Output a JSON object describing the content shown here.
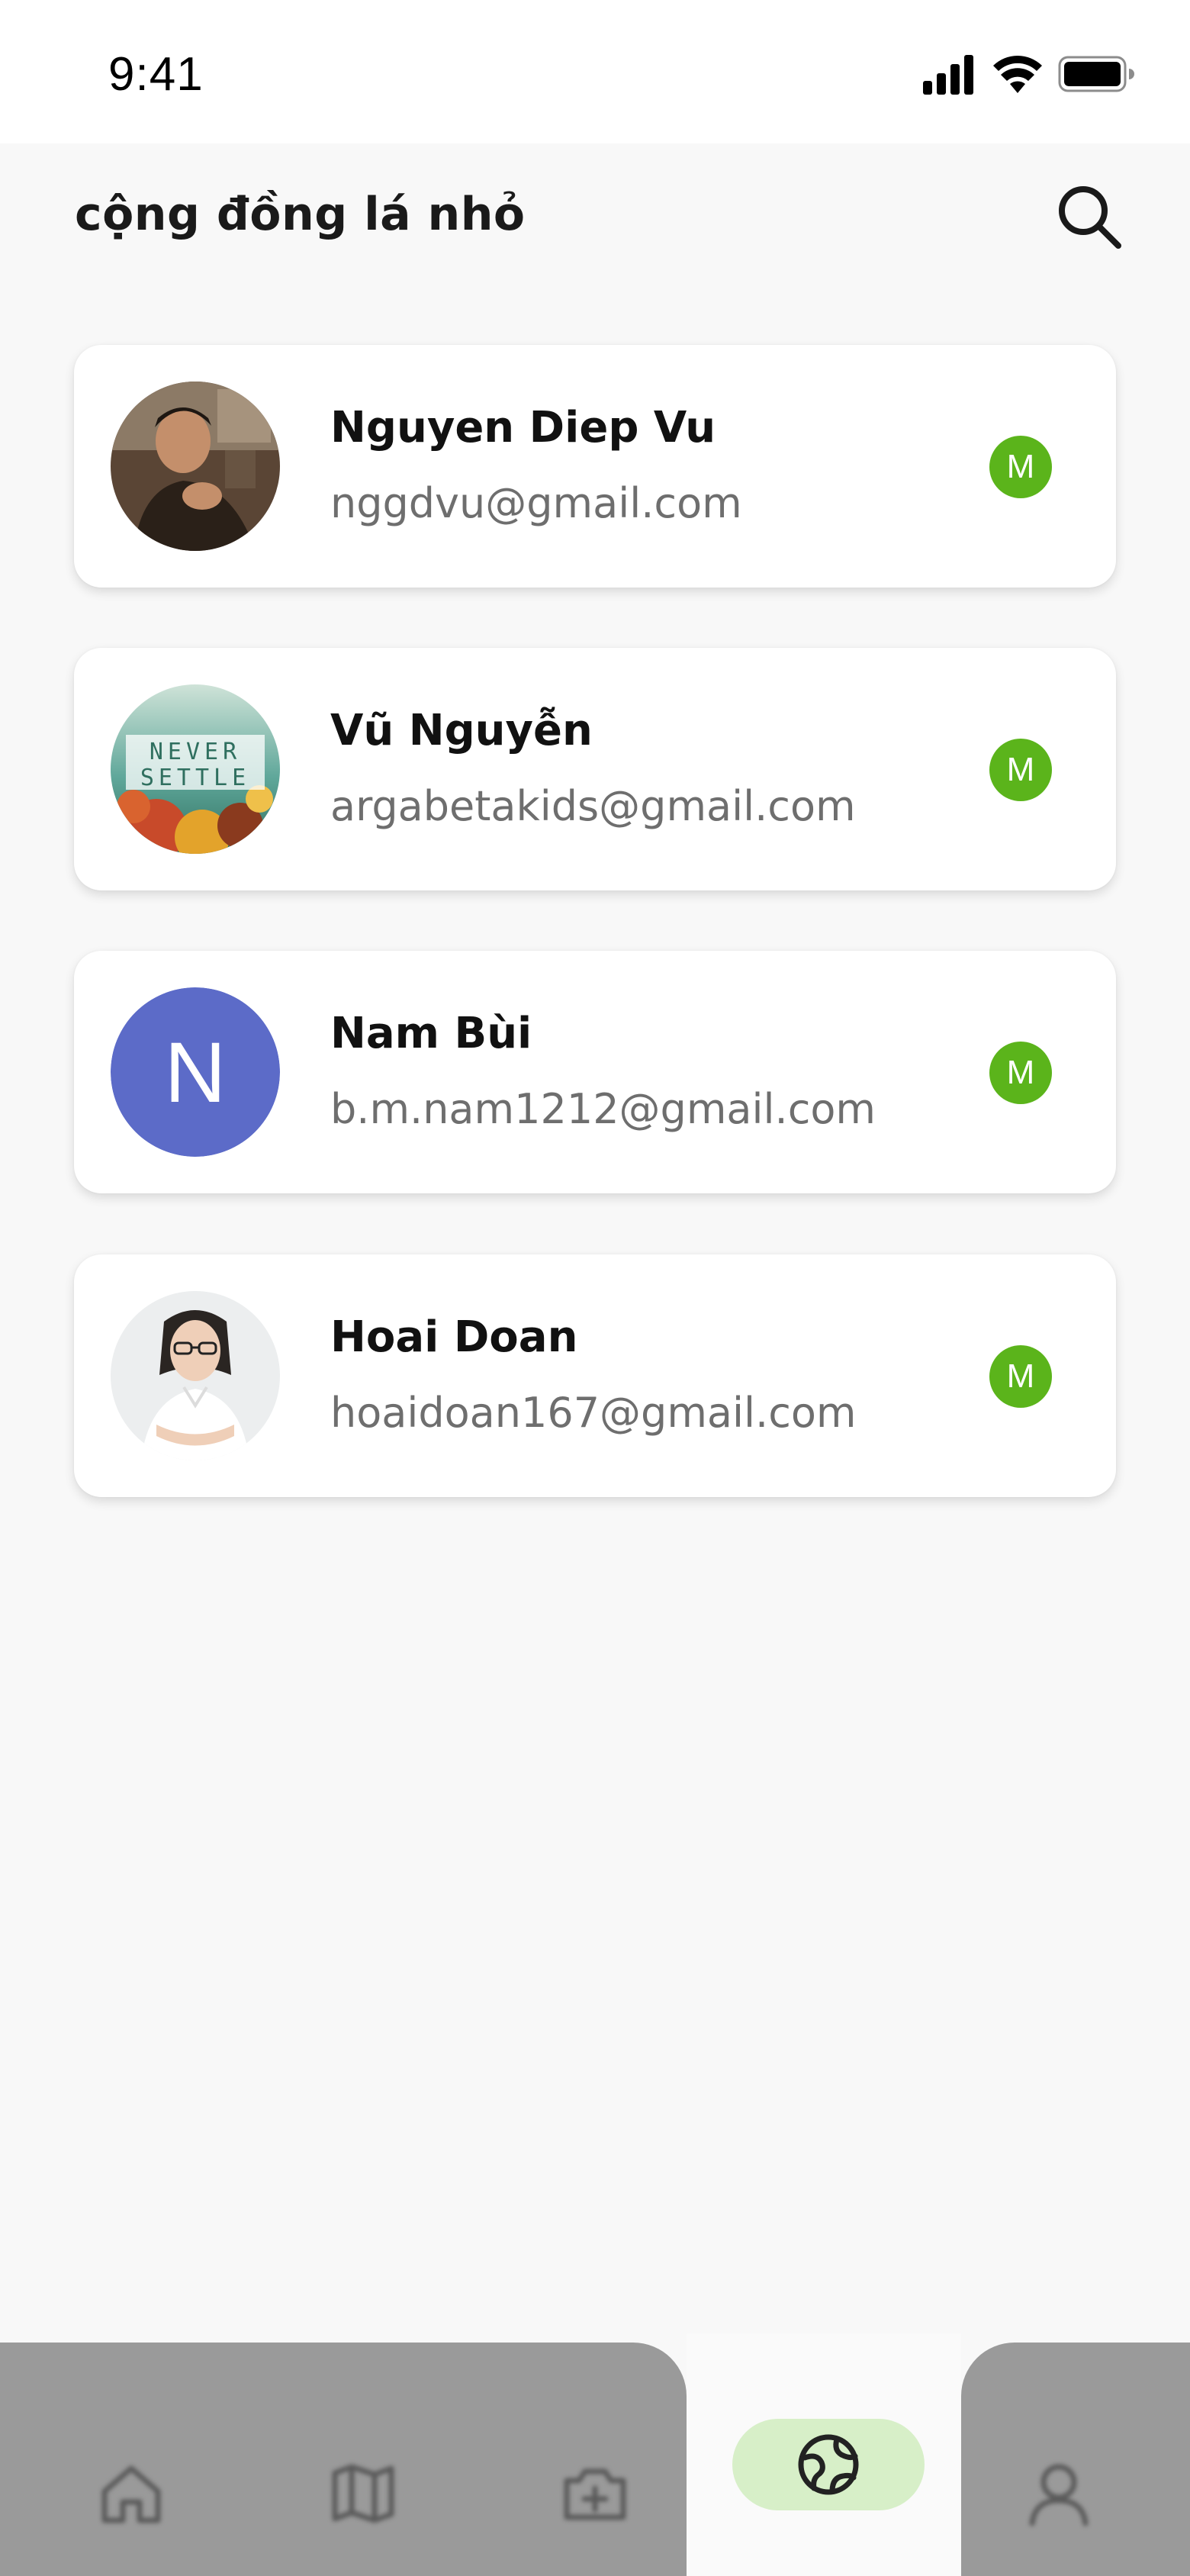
{
  "status_bar": {
    "time": "9:41"
  },
  "header": {
    "title": "cộng đồng lá nhỏ"
  },
  "users": [
    {
      "name": "Nguyen Diep Vu",
      "email": "nggdvu@gmail.com",
      "badge": "M",
      "avatar": "photo"
    },
    {
      "name": "Vũ Nguyễn",
      "email": "argabetakids@gmail.com",
      "badge": "M",
      "avatar": "never-settle-image",
      "avatar_text_1": "NEVER",
      "avatar_text_2": "SETTLE"
    },
    {
      "name": "Nam Bùi",
      "email": "b.m.nam1212@gmail.com",
      "badge": "M",
      "avatar": "letter",
      "avatar_letter": "N"
    },
    {
      "name": "Hoai Doan",
      "email": "hoaidoan167@gmail.com",
      "badge": "M",
      "avatar": "photo"
    }
  ],
  "bottom_nav": {
    "items": [
      {
        "icon": "home-icon"
      },
      {
        "icon": "map-icon"
      },
      {
        "icon": "camera-plus-icon"
      },
      {
        "icon": "community-globe-icon",
        "active": true
      },
      {
        "icon": "profile-icon"
      }
    ]
  },
  "colors": {
    "badge": "#5bb41b",
    "letter_avatar": "#5c6bc8",
    "nav_active_pill": "#d7efc8",
    "nav_background": "#9a9a9a"
  }
}
